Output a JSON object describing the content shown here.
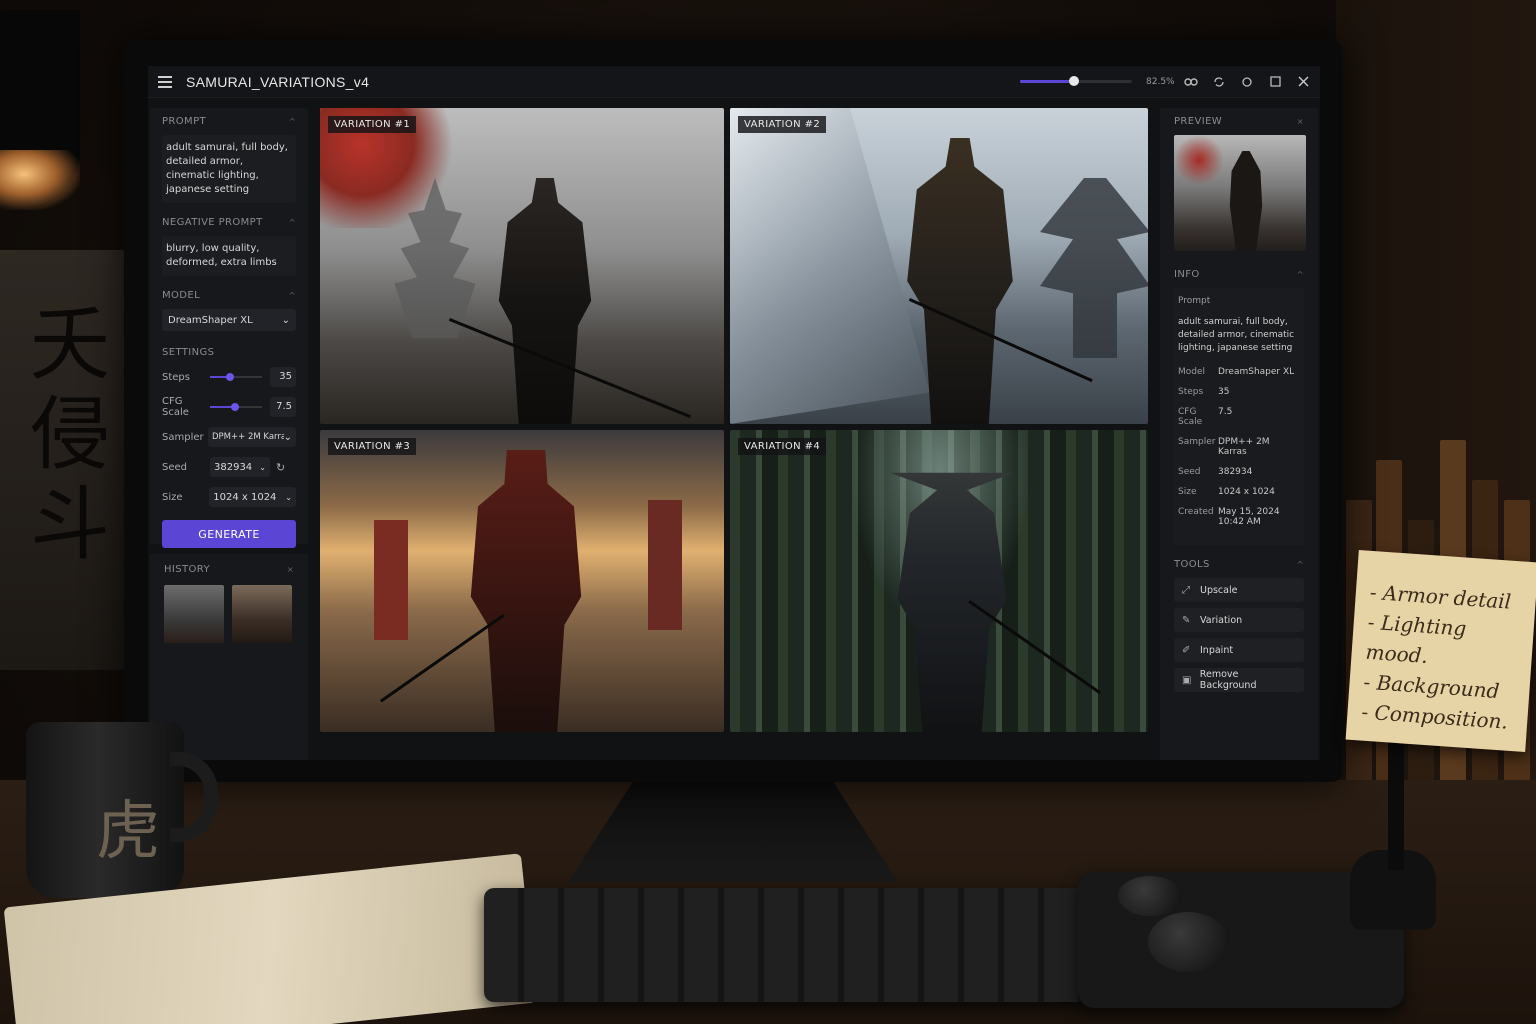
{
  "window": {
    "title": "SAMURAI_VARIATIONS_v4",
    "zoom_label": "82.5%",
    "zoom_fraction": 0.48
  },
  "left": {
    "prompt_head": "PROMPT",
    "prompt_text": "adult samurai, full body, detailed armor, cinematic lighting, japanese setting",
    "negative_head": "NEGATIVE PROMPT",
    "negative_text": "blurry, low quality, deformed, extra limbs",
    "model_head": "MODEL",
    "model_value": "DreamShaper XL",
    "settings_head": "SETTINGS",
    "steps_label": "Steps",
    "steps_value": "35",
    "steps_fraction": 0.4,
    "cfg_label": "CFG Scale",
    "cfg_value": "7.5",
    "cfg_fraction": 0.5,
    "sampler_label": "Sampler",
    "sampler_value": "DPM++ 2M Karras",
    "seed_label": "Seed",
    "seed_value": "382934",
    "size_label": "Size",
    "size_value": "1024 x 1024",
    "generate_label": "GENERATE",
    "history_head": "HISTORY"
  },
  "tiles": [
    {
      "label": "VARIATION #1"
    },
    {
      "label": "VARIATION #2"
    },
    {
      "label": "VARIATION #3"
    },
    {
      "label": "VARIATION #4"
    }
  ],
  "right": {
    "preview_head": "PREVIEW",
    "info_head": "INFO",
    "prompt_key": "Prompt",
    "prompt_text": "adult samurai, full body, detailed armor, cinematic lighting, japanese setting",
    "model_key": "Model",
    "model_value": "DreamShaper XL",
    "steps_key": "Steps",
    "steps_value": "35",
    "cfg_key": "CFG Scale",
    "cfg_value": "7.5",
    "sampler_key": "Sampler",
    "sampler_value": "DPM++ 2M Karras",
    "seed_key": "Seed",
    "seed_value": "382934",
    "size_key": "Size",
    "size_value": "1024 x 1024",
    "created_key": "Created",
    "created_value": "May 15, 2024 10:42 AM",
    "tools_head": "TOOLS",
    "tools": [
      "Upscale",
      "Variation",
      "Inpaint",
      "Remove Background"
    ]
  },
  "sticky_note": [
    "- Armor detail",
    "- Lighting mood.",
    "- Background",
    "- Composition."
  ],
  "colors": {
    "accent": "#5a45d4",
    "panel": "#17181b",
    "screen": "#111214"
  }
}
